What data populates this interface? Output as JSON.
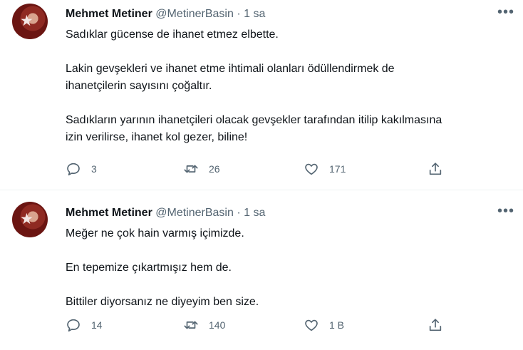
{
  "tweets": [
    {
      "name": "Mehmet Metiner",
      "handle": "@MetinerBasin",
      "dot": "·",
      "time": "1 sa",
      "paragraphs": [
        [
          "Sadıklar gücense de ihanet etmez elbette."
        ],
        [
          "Lakin gevşekleri ve ihanet etme ihtimali olanları ödüllendirmek de",
          "ihanetçilerin sayısını çoğaltır."
        ],
        [
          "Sadıkların yarının ihanetçileri olacak gevşekler tarafından itilip kakılmasına",
          "izin verilirse, ihanet kol gezer, biline!"
        ]
      ],
      "replies": "3",
      "retweets": "26",
      "likes": "171",
      "icons": [
        "comment-icon",
        "retweet-icon",
        "heart-icon",
        "share-icon",
        "more-icon"
      ]
    },
    {
      "name": "Mehmet Metiner",
      "handle": "@MetinerBasin",
      "dot": "·",
      "time": "1 sa",
      "paragraphs": [
        [
          "Meğer ne çok hain varmış içimizde."
        ],
        [
          "En tepemize çıkartmışız hem de."
        ],
        [
          "Bittiler diyorsanız ne diyeyim ben size."
        ]
      ],
      "replies": "14",
      "retweets": "140",
      "likes": "1 B",
      "icons": [
        "comment-icon",
        "retweet-icon",
        "heart-icon",
        "share-icon",
        "more-icon"
      ]
    }
  ]
}
